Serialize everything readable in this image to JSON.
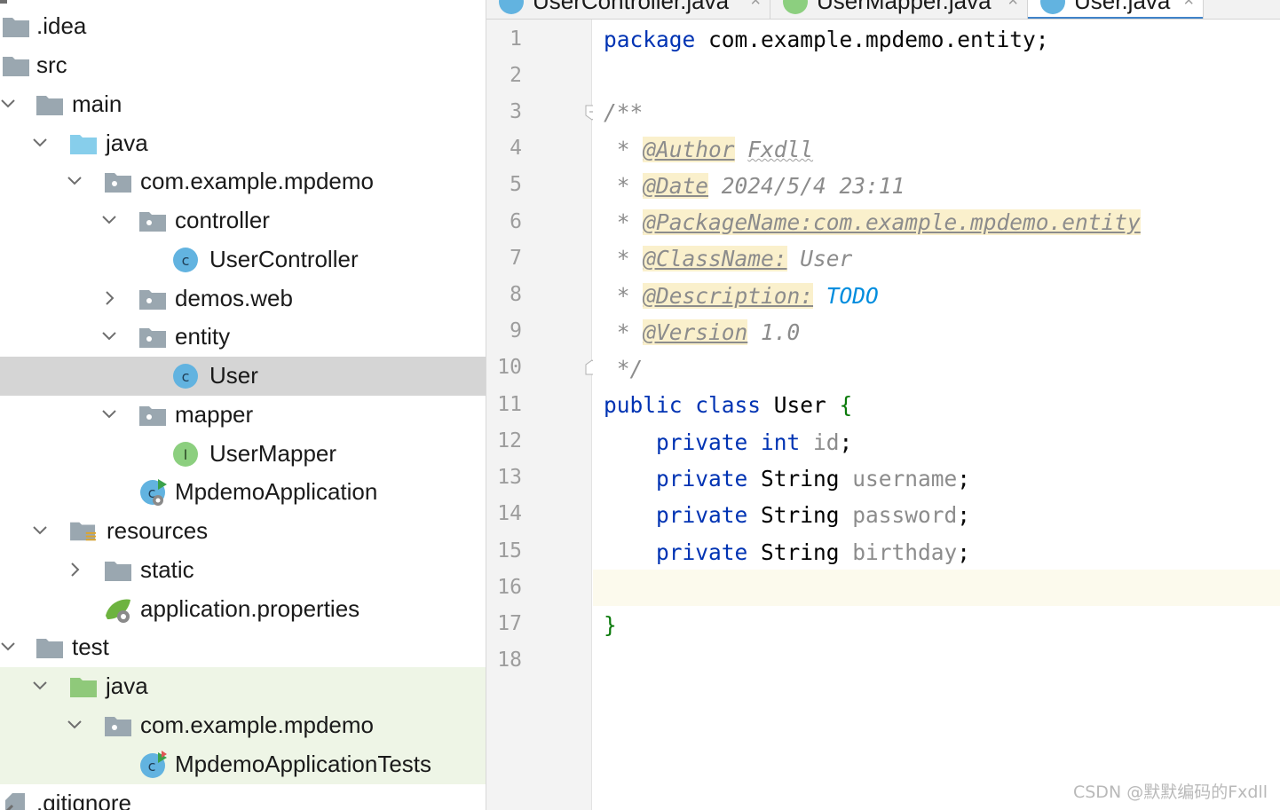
{
  "tree": {
    "items": [
      {
        "label": ".idea",
        "icon": "folder-icon"
      },
      {
        "label": "src",
        "icon": "folder-icon"
      },
      {
        "label": "main",
        "icon": "folder-icon",
        "expanded": true
      },
      {
        "label": "java",
        "icon": "source-folder-icon",
        "expanded": true
      },
      {
        "label": "com.example.mpdemo",
        "icon": "package-icon",
        "expanded": true
      },
      {
        "label": "controller",
        "icon": "package-icon",
        "expanded": true
      },
      {
        "label": "UserController",
        "icon": "class-icon"
      },
      {
        "label": "demos.web",
        "icon": "package-icon",
        "expanded": false
      },
      {
        "label": "entity",
        "icon": "package-icon",
        "expanded": true
      },
      {
        "label": "User",
        "icon": "class-icon",
        "selected": true
      },
      {
        "label": "mapper",
        "icon": "package-icon",
        "expanded": true
      },
      {
        "label": "UserMapper",
        "icon": "interface-icon"
      },
      {
        "label": "MpdemoApplication",
        "icon": "spring-boot-class-icon"
      },
      {
        "label": "resources",
        "icon": "resources-folder-icon",
        "expanded": true
      },
      {
        "label": "static",
        "icon": "folder-icon",
        "expanded": false
      },
      {
        "label": "application.properties",
        "icon": "spring-properties-icon"
      },
      {
        "label": "test",
        "icon": "folder-icon",
        "expanded": true
      },
      {
        "label": "java",
        "icon": "test-source-folder-icon",
        "expanded": true
      },
      {
        "label": "com.example.mpdemo",
        "icon": "package-icon",
        "expanded": true
      },
      {
        "label": "MpdemoApplicationTests",
        "icon": "test-class-icon"
      },
      {
        "label": ".gitignore",
        "icon": "ignore-file-icon"
      }
    ]
  },
  "tabs": [
    {
      "label": "UserController.java",
      "icon": "class-icon"
    },
    {
      "label": "UserMapper.java",
      "icon": "interface-icon"
    },
    {
      "label": "User.java",
      "icon": "class-icon",
      "active": true
    }
  ],
  "editor": {
    "line_numbers": [
      "1",
      "2",
      "3",
      "4",
      "5",
      "6",
      "7",
      "8",
      "9",
      "10",
      "11",
      "12",
      "13",
      "14",
      "15",
      "16",
      "17",
      "18"
    ],
    "current_line": "16",
    "code": {
      "l1_kw": "package",
      "l1_rest": " com.example.mpdemo.entity;",
      "l3": "/**",
      "l4_star": " * ",
      "l4_tag": "@Author",
      "l4_sp": " ",
      "l4_val": "Fxdll",
      "l5_star": " * ",
      "l5_tag": "@Date",
      "l5_val": " 2024/5/4 23:11",
      "l6_star": " * ",
      "l6_tag": "@PackageName:com.example.mpdemo.entity",
      "l7_star": " * ",
      "l7_tag": "@ClassName:",
      "l7_val": " User",
      "l8_star": " * ",
      "l8_tag": "@Description:",
      "l8_sp": " ",
      "l8_val": "TODO",
      "l9_star": " * ",
      "l9_tag": "@Version",
      "l9_val": " 1.0",
      "l10": " */",
      "l11_kw": "public class",
      "l11_cls": " User ",
      "l11_brace": "{",
      "l12_kw": "    private",
      "l12_typ": " int",
      "l12_fld": " id",
      "l12_end": ";",
      "l13_kw": "    private",
      "l13_typ": " String",
      "l13_fld": " username",
      "l13_end": ";",
      "l14_kw": "    private",
      "l14_typ": " String",
      "l14_fld": " password",
      "l14_end": ";",
      "l15_kw": "    private",
      "l15_typ": " String",
      "l15_fld": " birthday",
      "l15_end": ";",
      "l17": "}"
    }
  },
  "watermark": "CSDN @默默编码的Fxdll",
  "colors": {
    "keyword": "#0033b3",
    "comment": "#8c8c8c",
    "todo": "#008dde",
    "selection": "#d5d5d5",
    "test_bg": "#eef5e6",
    "folder": "#9aa7b0",
    "source_folder": "#87ceeb",
    "test_folder": "#8fc97a",
    "class_badge": "#62b3e0",
    "interface_badge": "#8ccf7f"
  }
}
